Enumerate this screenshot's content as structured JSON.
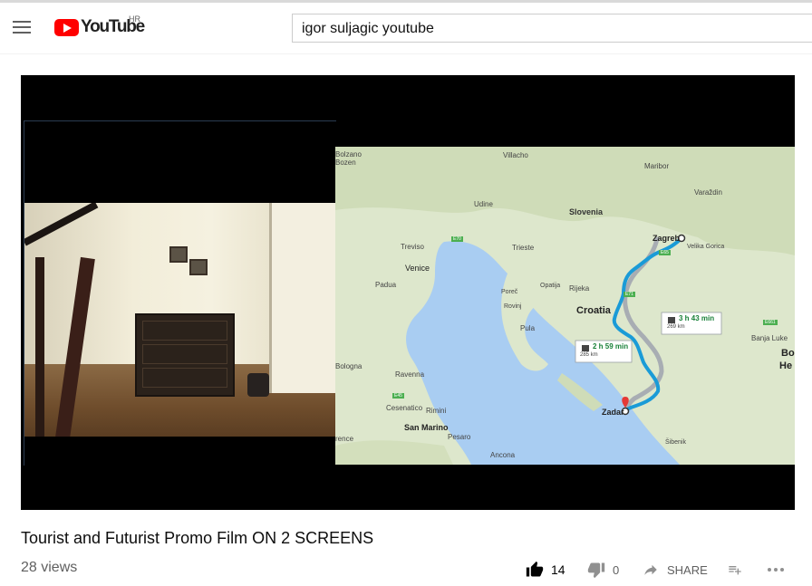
{
  "masthead": {
    "logo_text": "YouTube",
    "region": "HR",
    "search_value": "igor suljagic youtube"
  },
  "video": {
    "title": "Tourist and Futurist Promo Film ON 2 SCREENS",
    "views": "28 views",
    "likes": "14",
    "dislikes": "0",
    "share_label": "SHARE"
  },
  "map": {
    "labels": {
      "bolzano": "Bolzano",
      "bozen": "Bozen",
      "villacho": "Villacho",
      "maribor": "Maribor",
      "varazdin": "Varaždin",
      "udine": "Udine",
      "slovenia": "Slovenia",
      "zagreb": "Zagreb",
      "velika_gorica": "Velika Gorica",
      "treviso": "Treviso",
      "trieste": "Trieste",
      "venice": "Venice",
      "padua": "Padua",
      "porec": "Poreč",
      "rijeka": "Rijeka",
      "opatija": "Opatija",
      "rovinj": "Rovinj",
      "croatia": "Croatia",
      "pula": "Pula",
      "bologna": "Bologna",
      "ravenna": "Ravenna",
      "cesenatico": "Cesenatico",
      "rimini": "Rimini",
      "san_marino": "San Marino",
      "pesaro": "Pesaro",
      "florence": "rence",
      "zadar": "Zadar",
      "sibenik": "Šibenik",
      "ancona": "Ancona",
      "banja_luka": "Banja Luke",
      "bo": "Bo",
      "he": "He",
      "route1_time": "2 h 59 min",
      "route1_dist": "285 km",
      "route2_time": "3 h 43 min",
      "route2_dist": "269 km",
      "e70": "E70",
      "e65": "E65",
      "e71": "E71",
      "e45": "E45",
      "e661": "E661"
    }
  },
  "colors": {
    "brand_red": "#ff0000",
    "route_blue": "#1a9bd7",
    "alt_route_gray": "#a8adb3",
    "sea": "#a9cdf2"
  }
}
